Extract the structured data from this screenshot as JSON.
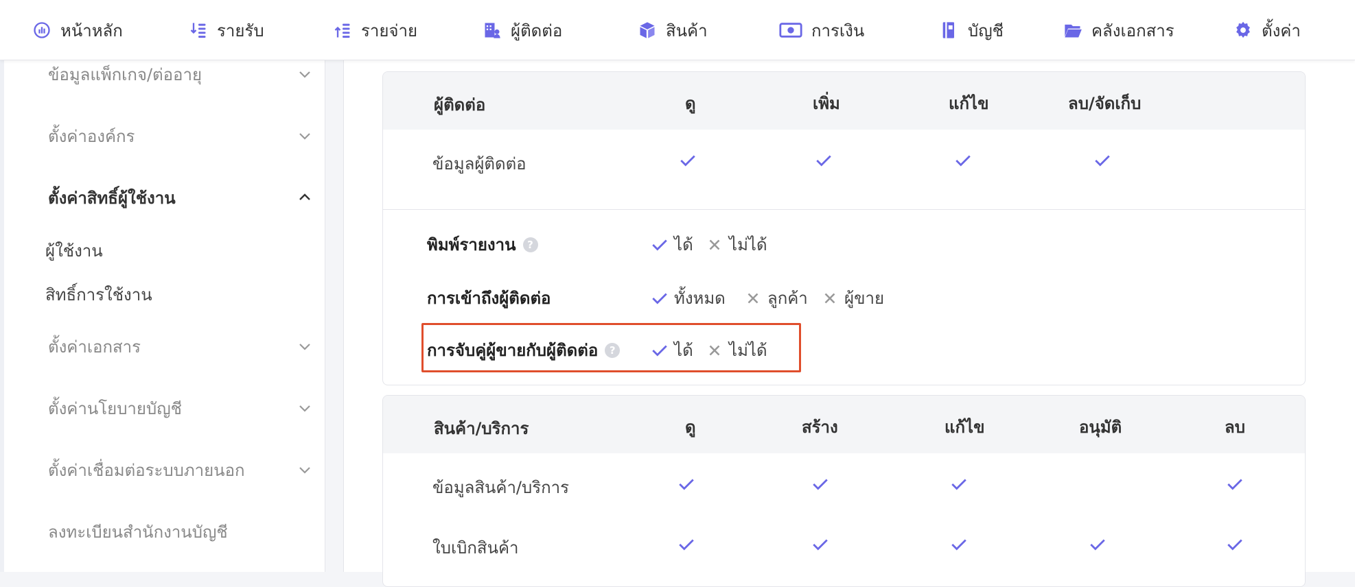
{
  "nav": {
    "items": [
      {
        "label": "หน้าหลัก",
        "icon": "dashboard-icon"
      },
      {
        "label": "รายรับ",
        "icon": "income-icon"
      },
      {
        "label": "รายจ่าย",
        "icon": "expense-icon"
      },
      {
        "label": "ผู้ติดต่อ",
        "icon": "contacts-icon"
      },
      {
        "label": "สินค้า",
        "icon": "box-icon"
      },
      {
        "label": "การเงิน",
        "icon": "money-icon"
      },
      {
        "label": "บัญชี",
        "icon": "ledger-icon"
      },
      {
        "label": "คลังเอกสาร",
        "icon": "folder-icon"
      },
      {
        "label": "ตั้งค่า",
        "icon": "gear-icon"
      }
    ],
    "accent": "#6a67e6"
  },
  "sidebar": {
    "sections": [
      {
        "label": "ข้อมูลแพ็กเกจ/ต่ออายุ"
      },
      {
        "label": "ตั้งค่าองค์กร"
      },
      {
        "label": "ตั้งค่าสิทธิ์ผู้ใช้งาน"
      },
      {
        "label": "ตั้งค่าเอกสาร"
      },
      {
        "label": "ตั้งค่านโยบายบัญชี"
      },
      {
        "label": "ตั้งค่าเชื่อมต่อระบบภายนอก"
      },
      {
        "label": "ลงทะเบียนสำนักงานบัญชี"
      }
    ],
    "sub_items": [
      {
        "label": "ผู้ใช้งาน"
      },
      {
        "label": "สิทธิ์การใช้งาน"
      }
    ]
  },
  "contacts_card": {
    "headers": [
      "ผู้ติดต่อ",
      "ดู",
      "เพิ่ม",
      "แก้ไข",
      "ลบ/จัดเก็บ"
    ],
    "row_label": "ข้อมูลผู้ติดต่อ",
    "options": {
      "print_report": {
        "label": "พิมพ์รายงาน",
        "yes": "ได้",
        "no": "ไม่ได้"
      },
      "contact_access": {
        "label": "การเข้าถึงผู้ติดต่อ",
        "all": "ทั้งหมด",
        "customer": "ลูกค้า",
        "vendor": "ผู้ขาย"
      },
      "match_seller": {
        "label": "การจับคู่ผู้ขายกับผู้ติดต่อ",
        "yes": "ได้",
        "no": "ไม่ได้"
      }
    }
  },
  "products_card": {
    "headers": [
      "สินค้า/บริการ",
      "ดู",
      "สร้าง",
      "แก้ไข",
      "อนุมัติ",
      "ลบ"
    ],
    "rows": [
      {
        "label": "ข้อมูลสินค้า/บริการ"
      },
      {
        "label": "ใบเบิกสินค้า"
      }
    ]
  },
  "colors": {
    "check": "#6a67e6",
    "highlight": "#e04e2c"
  }
}
